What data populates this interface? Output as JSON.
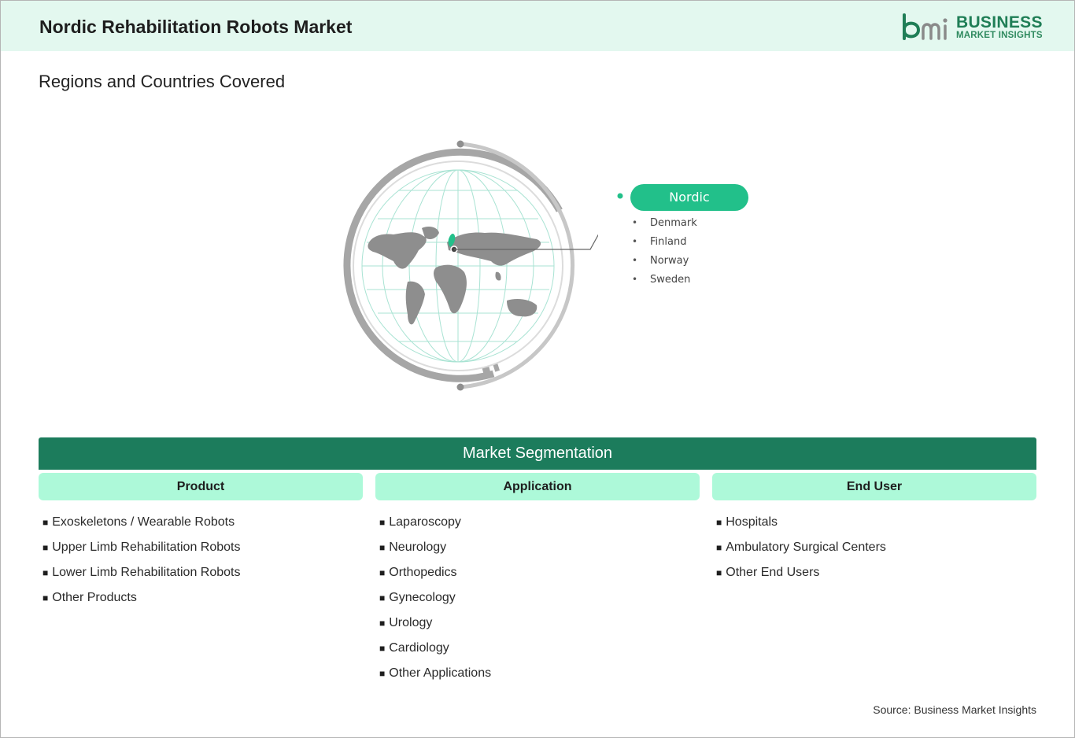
{
  "header": {
    "title": "Nordic Rehabilitation Robots Market",
    "logo": {
      "mark": "bmi",
      "line1": "BUSINESS",
      "line2": "MARKET INSIGHTS",
      "brand_color": "#1f7e56"
    }
  },
  "regions": {
    "section_title": "Regions and Countries Covered",
    "globe_icon": "world-globe-icon",
    "region": "Nordic",
    "region_color": "#22c08a",
    "countries": [
      "Denmark",
      "Finland",
      "Norway",
      "Sweden"
    ]
  },
  "segmentation": {
    "title": "Market Segmentation",
    "banner_color": "#1c7c5c",
    "header_color": "#adf9d9",
    "columns": [
      {
        "heading": "Product",
        "items": [
          "Exoskeletons / Wearable Robots",
          "Upper Limb Rehabilitation Robots",
          "Lower Limb Rehabilitation Robots",
          "Other Products"
        ]
      },
      {
        "heading": "Application",
        "items": [
          "Laparoscopy",
          "Neurology",
          "Orthopedics",
          "Gynecology",
          "Urology",
          "Cardiology",
          "Other Applications"
        ]
      },
      {
        "heading": "End User",
        "items": [
          "Hospitals",
          "Ambulatory Surgical Centers",
          "Other End Users"
        ]
      }
    ]
  },
  "source": "Source: Business Market Insights"
}
